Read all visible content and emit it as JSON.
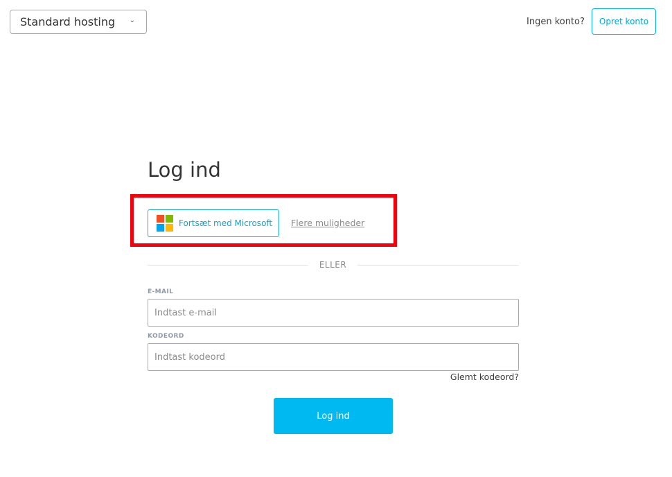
{
  "header": {
    "hosting_select": {
      "value": "Standard hosting",
      "icon": "chevron-down-icon"
    },
    "no_account_text": "Ingen konto?",
    "create_account_label": "Opret konto"
  },
  "login": {
    "title": "Log ind",
    "microsoft_button_label": "Fortsæt med Microsoft",
    "more_options_label": "Flere muligheder",
    "divider_text": "ELLER",
    "email": {
      "label": "E-MAIL",
      "placeholder": "Indtast e-mail",
      "value": ""
    },
    "password": {
      "label": "KODEORD",
      "placeholder": "Indtast kodeord",
      "value": ""
    },
    "forgot_password_label": "Glemt kodeord?",
    "submit_label": "Log ind"
  },
  "colors": {
    "accent": "#00b9f1",
    "highlight": "#f5000a",
    "microsoft_red": "#f25022",
    "microsoft_green": "#7fba00",
    "microsoft_blue": "#00a4ef",
    "microsoft_yellow": "#ffb900"
  }
}
